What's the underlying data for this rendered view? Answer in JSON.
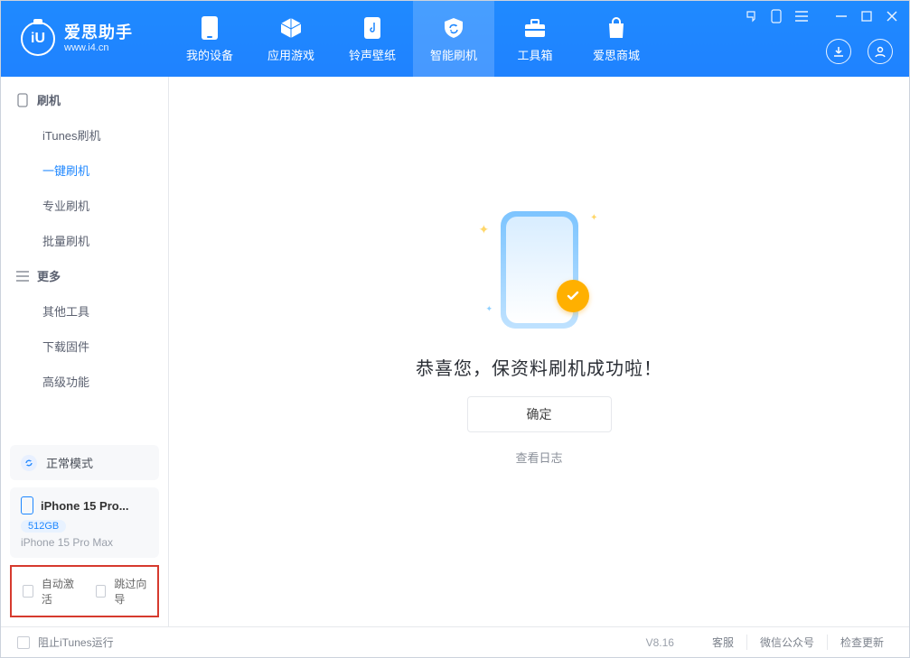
{
  "brand": {
    "title": "爱思助手",
    "url": "www.i4.cn"
  },
  "nav": [
    {
      "id": "device",
      "label": "我的设备"
    },
    {
      "id": "apps",
      "label": "应用游戏"
    },
    {
      "id": "ring",
      "label": "铃声壁纸"
    },
    {
      "id": "flash",
      "label": "智能刷机"
    },
    {
      "id": "tools",
      "label": "工具箱"
    },
    {
      "id": "shop",
      "label": "爱思商城"
    }
  ],
  "sidebar": {
    "groups": [
      {
        "title": "刷机",
        "items": [
          {
            "id": "itunes",
            "label": "iTunes刷机"
          },
          {
            "id": "onekey",
            "label": "一键刷机"
          },
          {
            "id": "pro",
            "label": "专业刷机"
          },
          {
            "id": "batch",
            "label": "批量刷机"
          }
        ]
      },
      {
        "title": "更多",
        "items": [
          {
            "id": "other",
            "label": "其他工具"
          },
          {
            "id": "firmware",
            "label": "下载固件"
          },
          {
            "id": "advanced",
            "label": "高级功能"
          }
        ]
      }
    ]
  },
  "mode": {
    "label": "正常模式"
  },
  "device": {
    "name": "iPhone 15 Pro...",
    "storage": "512GB",
    "model": "iPhone 15 Pro Max"
  },
  "options": {
    "auto_activate": "自动激活",
    "skip_wizard": "跳过向导"
  },
  "main": {
    "message": "恭喜您，保资料刷机成功啦！",
    "ok": "确定",
    "log": "查看日志"
  },
  "footer": {
    "block_itunes": "阻止iTunes运行",
    "version": "V8.16",
    "links": [
      "客服",
      "微信公众号",
      "检查更新"
    ]
  },
  "colors": {
    "accent": "#1e87ff",
    "warn": "#d63a2e",
    "gold": "#ffb000"
  }
}
